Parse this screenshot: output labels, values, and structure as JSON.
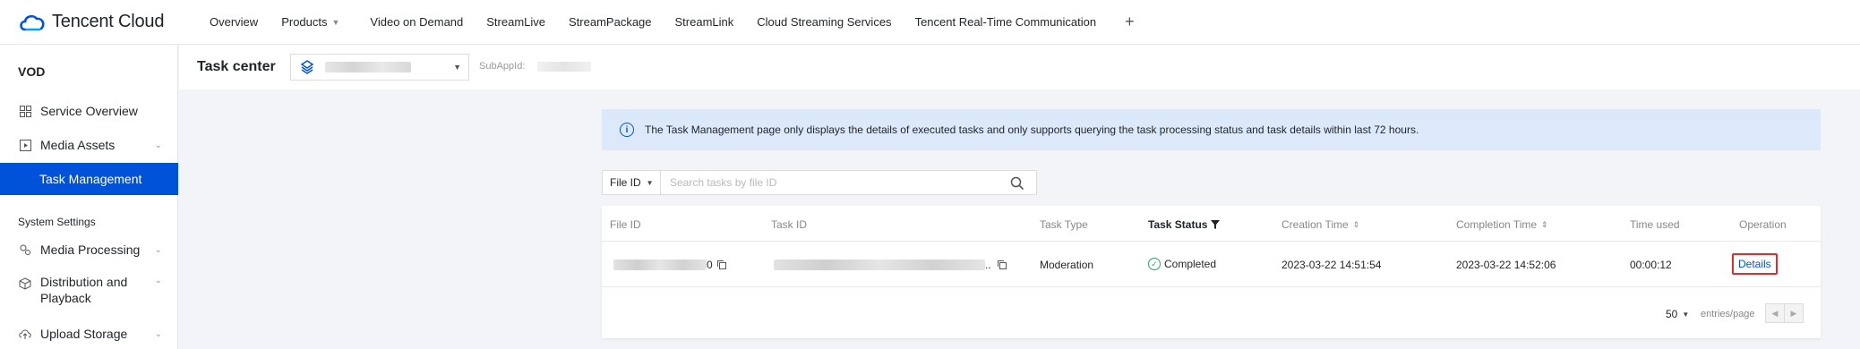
{
  "topnav": {
    "logo_text": "Tencent Cloud",
    "items": [
      {
        "label": "Overview",
        "has_caret": false
      },
      {
        "label": "Products",
        "has_caret": true
      },
      {
        "label": "Video on Demand",
        "has_caret": false
      },
      {
        "label": "StreamLive",
        "has_caret": false
      },
      {
        "label": "StreamPackage",
        "has_caret": false
      },
      {
        "label": "StreamLink",
        "has_caret": false
      },
      {
        "label": "Cloud Streaming Services",
        "has_caret": false
      },
      {
        "label": "Tencent Real-Time Communication",
        "has_caret": false
      }
    ],
    "plus": "+"
  },
  "sidebar": {
    "title": "VOD",
    "items": [
      {
        "label": "Service Overview",
        "icon": "grid-icon"
      },
      {
        "label": "Media Assets",
        "icon": "play-square-icon"
      },
      {
        "label": "Task Management",
        "icon": ""
      }
    ],
    "section_label": "System Settings",
    "settings_items": [
      {
        "label": "Media Processing",
        "icon": "gears-icon"
      },
      {
        "label": "Distribution and Playback",
        "icon": "cube-icon"
      },
      {
        "label": "Upload Storage",
        "icon": "upload-cloud-icon"
      }
    ]
  },
  "header": {
    "title": "Task center",
    "subapp_label": "SubAppId:"
  },
  "banner": {
    "text": "The Task Management page only displays the details of executed tasks and only supports querying the task processing status and task details within last 72 hours."
  },
  "search": {
    "filter_label": "File ID",
    "placeholder": "Search tasks by file ID"
  },
  "table": {
    "columns": [
      "File ID",
      "Task ID",
      "Task Type",
      "Task Status",
      "Creation Time",
      "Completion Time",
      "Time used",
      "Operation"
    ],
    "rows": [
      {
        "file_id_suffix": "0",
        "task_id_suffix": "..",
        "task_type": "Moderation",
        "status": "Completed",
        "creation_time": "2023-03-22 14:51:54",
        "completion_time": "2023-03-22 14:52:06",
        "time_used": "00:00:12",
        "operation": "Details"
      }
    ]
  },
  "pagination": {
    "page_size": "50",
    "label": "entries/page"
  },
  "colors": {
    "brand": "#0052d9",
    "success": "#2ba471",
    "highlight": "#e32b2b",
    "banner_bg": "#dce9fb"
  }
}
